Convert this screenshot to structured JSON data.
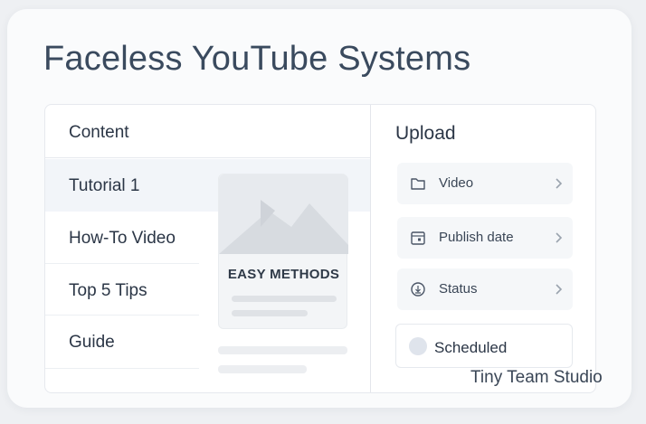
{
  "page": {
    "title": "Faceless YouTube Systems"
  },
  "content": {
    "header": "Content",
    "items": [
      {
        "label": "Tutorial 1",
        "selected": true
      },
      {
        "label": "How-To Video",
        "selected": false
      },
      {
        "label": "Top 5 Tips",
        "selected": false
      },
      {
        "label": "Guide",
        "selected": false
      }
    ],
    "preview": {
      "title": "EASY METHODS",
      "icon": "image-placeholder-icon"
    }
  },
  "upload": {
    "title": "Upload",
    "rows": [
      {
        "label": "Video",
        "icon": "folder-icon"
      },
      {
        "label": "Publish date",
        "icon": "calendar-icon"
      },
      {
        "label": "Status",
        "icon": "status-circle-icon"
      }
    ],
    "status_value": "Scheduled"
  },
  "footer": {
    "brand": "Tiny Team Studio"
  },
  "colors": {
    "background": "#eef0f3",
    "card": "#fafbfc",
    "title": "#3a4a5e",
    "selected_row": "#f2f5f9"
  }
}
